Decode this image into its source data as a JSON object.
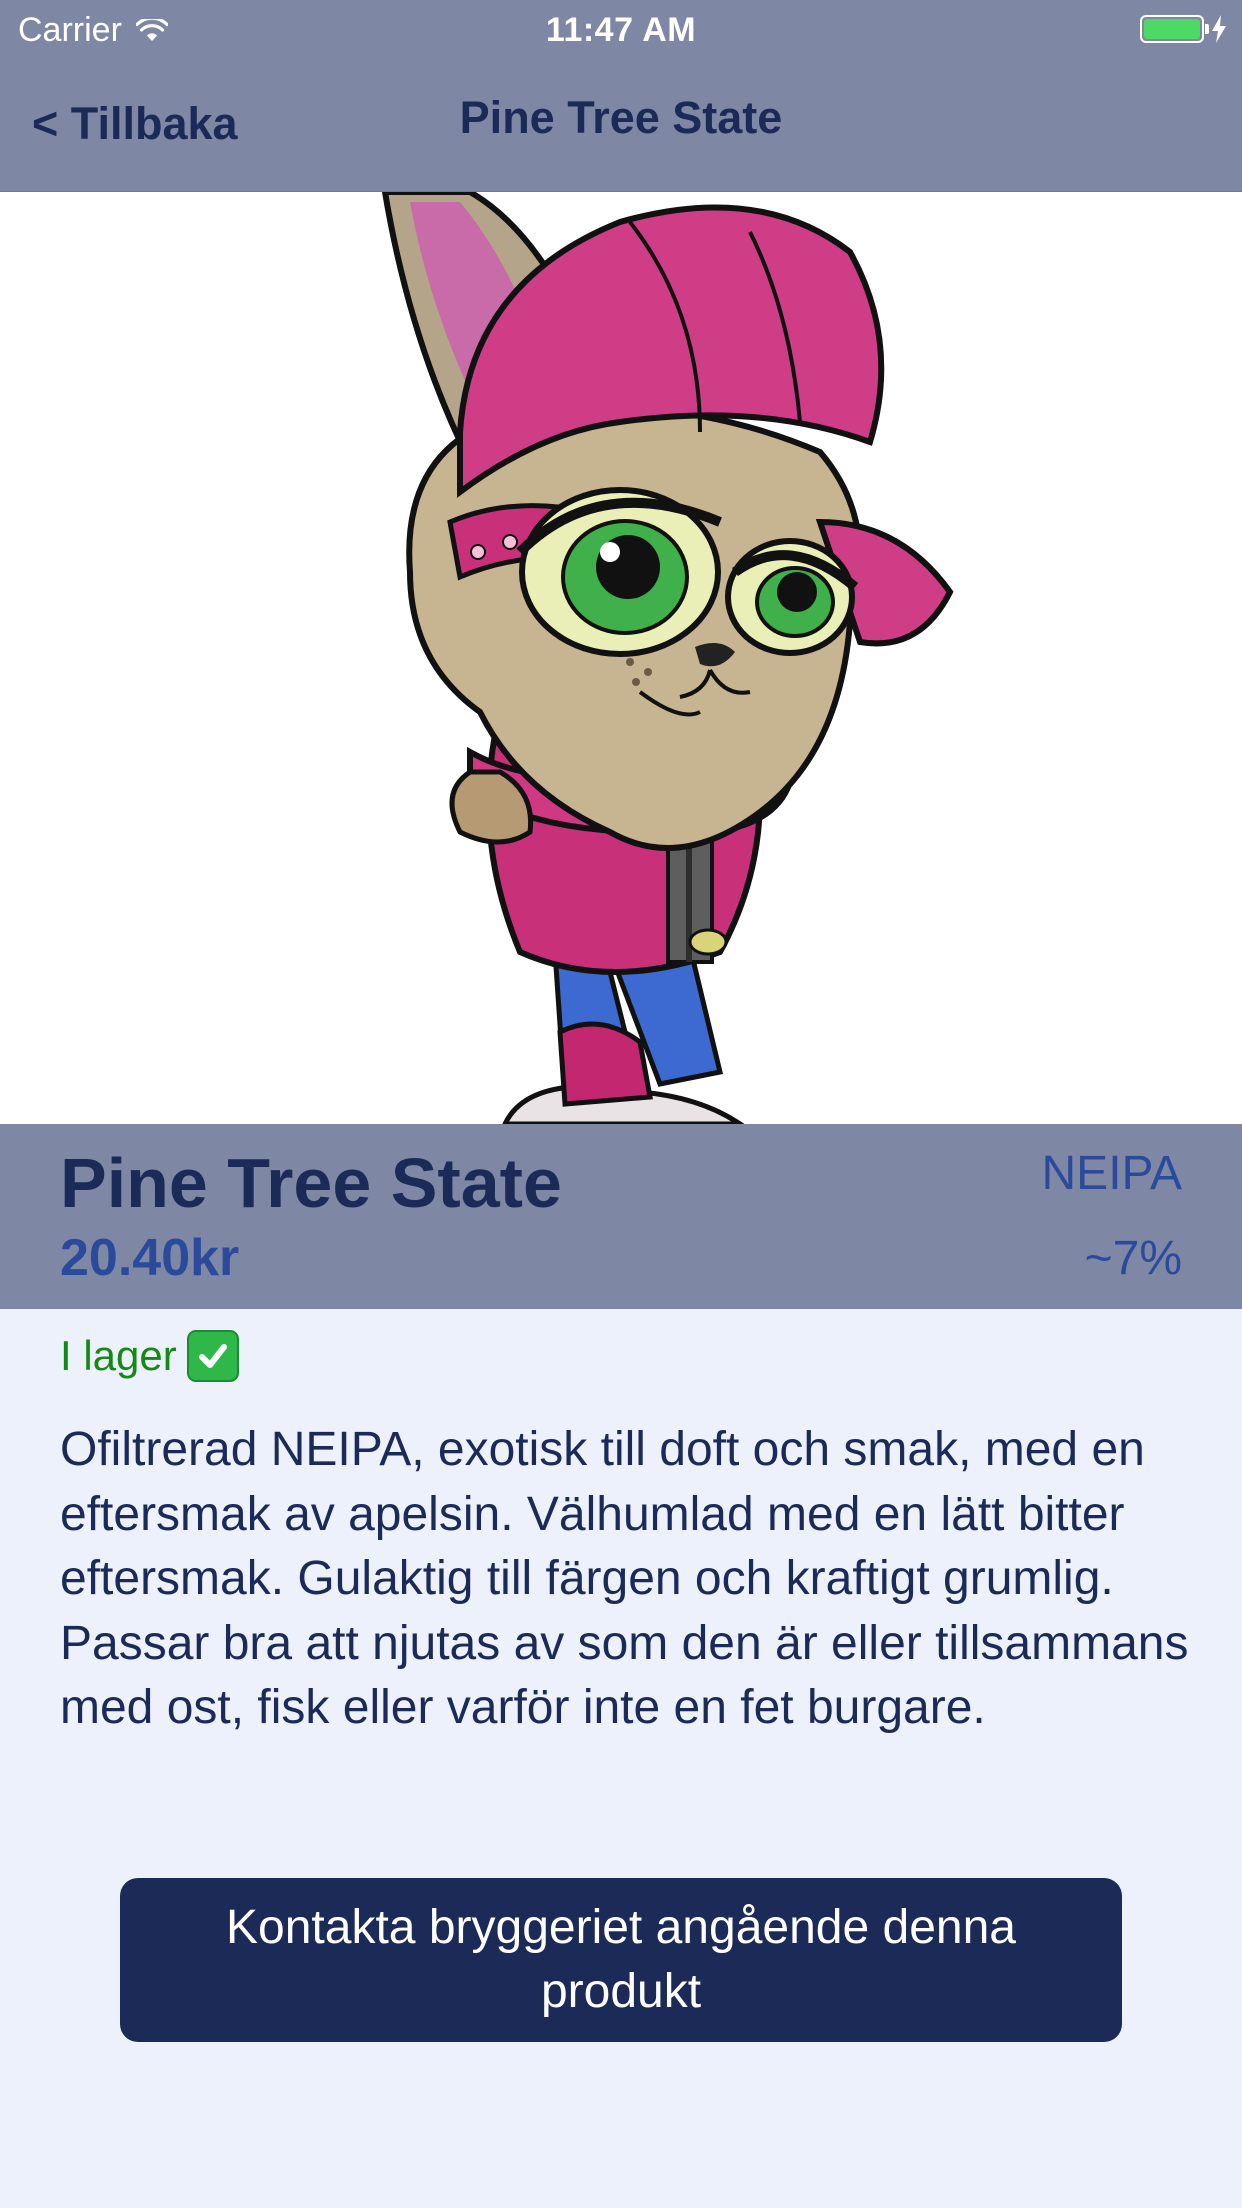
{
  "status_bar": {
    "carrier": "Carrier",
    "time": "11:47 AM",
    "icons": [
      "wifi-icon",
      "battery-icon",
      "charging-icon"
    ]
  },
  "nav": {
    "back_label": "< Tillbaka",
    "title": "Pine Tree State"
  },
  "product": {
    "image_icon": "cartoon-cat-mascot",
    "name": "Pine Tree State",
    "price": "20.40kr",
    "style": "NEIPA",
    "abv": "~7%",
    "stock_label": "I lager",
    "stock_icon": "check-mark-icon",
    "description": "Ofiltrerad NEIPA, exotisk till doft och smak, med en eftersmak av apelsin. Välhumlad med en lätt bitter eftersmak. Gulaktig till färgen och kraftigt grumlig. Passar bra att njutas av som den är eller tillsammans med ost, fisk eller varför inte en fet burgare."
  },
  "actions": {
    "contact_label": "Kontakta bryggeriet angående denna produkt"
  },
  "colors": {
    "bar": "#7e88a4",
    "navy": "#1c2a58",
    "accent_blue": "#2c4a9c",
    "stock_green": "#138a13",
    "background": "#edf1fc"
  }
}
